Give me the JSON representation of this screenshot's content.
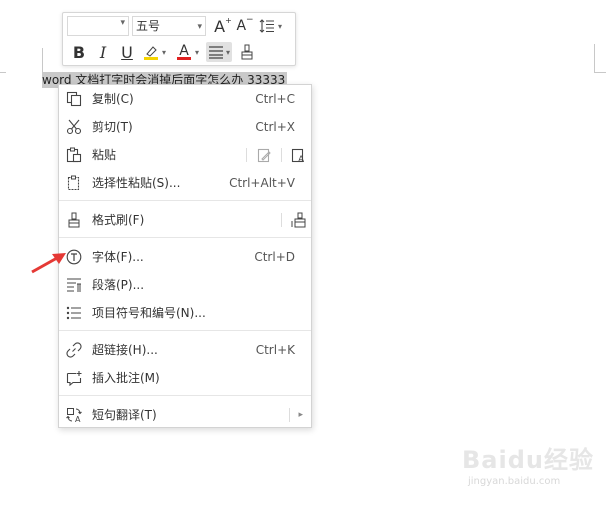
{
  "document": {
    "selected_text": "word 文档打字时会消掉后面字怎么办 33333"
  },
  "mini_toolbar": {
    "font_name": "",
    "font_size": "五号",
    "grow_font": "A",
    "shrink_font": "A",
    "bold": "B",
    "italic": "I",
    "underline": "U",
    "font_color": "A"
  },
  "context_menu": {
    "items": [
      {
        "label": "复制(C)",
        "shortcut": "Ctrl+C",
        "icon": "copy-icon"
      },
      {
        "label": "剪切(T)",
        "shortcut": "Ctrl+X",
        "icon": "scissors-icon"
      },
      {
        "label": "粘贴",
        "shortcut": "",
        "icon": "paste-icon"
      },
      {
        "label": "选择性粘贴(S)...",
        "shortcut": "Ctrl+Alt+V",
        "icon": "paste-special-icon"
      },
      {
        "label": "格式刷(F)",
        "shortcut": "",
        "icon": "format-painter-icon"
      },
      {
        "label": "字体(F)...",
        "shortcut": "Ctrl+D",
        "icon": "font-icon"
      },
      {
        "label": "段落(P)...",
        "shortcut": "",
        "icon": "paragraph-icon"
      },
      {
        "label": "项目符号和编号(N)...",
        "shortcut": "",
        "icon": "list-icon"
      },
      {
        "label": "超链接(H)...",
        "shortcut": "Ctrl+K",
        "icon": "link-icon"
      },
      {
        "label": "插入批注(M)",
        "shortcut": "",
        "icon": "comment-icon"
      },
      {
        "label": "短句翻译(T)",
        "shortcut": "",
        "icon": "translate-icon"
      }
    ]
  },
  "watermark": {
    "brand": "Baidu经验",
    "url": "jingyan.baidu.com"
  },
  "colors": {
    "annotation_arrow": "#e53935",
    "selection": "#c9c9c9"
  }
}
